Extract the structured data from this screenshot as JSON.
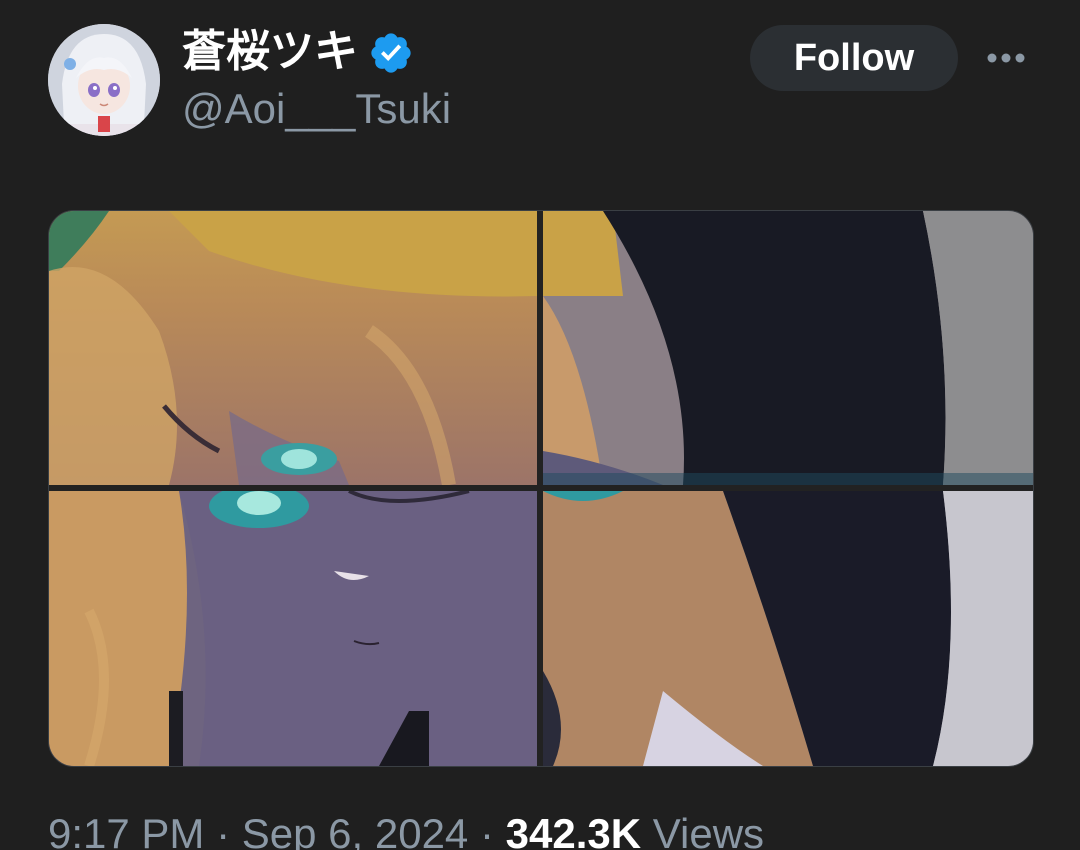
{
  "author": {
    "display_name": "蒼桜ツキ",
    "handle": "@Aoi___Tsuki",
    "verified": true
  },
  "actions": {
    "follow_label": "Follow",
    "more_icon": "more-horizontal-icon"
  },
  "media": {
    "layout": "4-image grid",
    "image_count": 4
  },
  "meta": {
    "time": "9:17 PM",
    "separator": "·",
    "date": "Sep 6, 2024",
    "views_count": "342.3K",
    "views_label": "Views"
  },
  "colors": {
    "background": "#1f1f1f",
    "verified_badge": "#1d9bf0",
    "follow_button_bg": "#2b2f33",
    "secondary_text": "#8b98a5"
  }
}
